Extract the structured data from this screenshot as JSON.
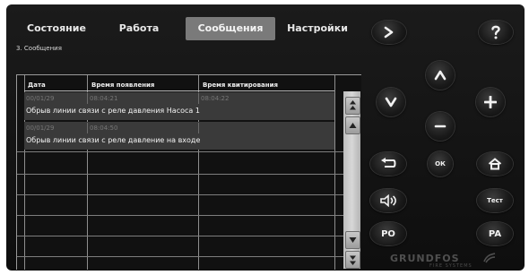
{
  "tabs": [
    {
      "label": "Состояние"
    },
    {
      "label": "Работа"
    },
    {
      "label": "Сообщения",
      "active": true
    },
    {
      "label": "Настройки"
    }
  ],
  "breadcrumb": "3. Сообщения",
  "table": {
    "columns": [
      "Дата",
      "Время появления",
      "Время квитирования"
    ],
    "messages": [
      {
        "date": "00/01/29",
        "appeared": "08:04:21",
        "acknowledged": "08:04:22",
        "text": "Обрыв линии связи с реле давления Насоса 1"
      },
      {
        "date": "00/01/29",
        "appeared": "08:04:50",
        "acknowledged": "",
        "text": "Обрыв линии связи с реле давление на входе"
      }
    ]
  },
  "controls": {
    "ok_label": "ОК",
    "test_label": "Тест",
    "po_label": "PO",
    "pa_label": "PA"
  },
  "logo": {
    "brand": "GRUNDFOS",
    "sub": "FIRE SYSTEMS"
  },
  "colors": {
    "panel": "#141414",
    "active_tab": "#7a7a7a",
    "message_row": "#3a3a3a",
    "text": "#f0f0f0"
  }
}
